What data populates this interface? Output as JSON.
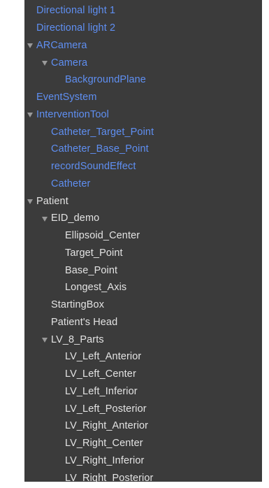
{
  "hierarchy": {
    "items": [
      {
        "label": "Directional light 1",
        "color": "blue",
        "expandable": false
      },
      {
        "label": "Directional light 2",
        "color": "blue",
        "expandable": false
      },
      {
        "label": "ARCamera",
        "color": "blue",
        "expandable": true
      },
      {
        "label": "Camera",
        "color": "blue",
        "expandable": true
      },
      {
        "label": "BackgroundPlane",
        "color": "blue",
        "expandable": false
      },
      {
        "label": "EventSystem",
        "color": "blue",
        "expandable": false
      },
      {
        "label": "InterventionTool",
        "color": "blue",
        "expandable": true
      },
      {
        "label": "Catheter_Target_Point",
        "color": "blue",
        "expandable": false
      },
      {
        "label": "Catheter_Base_Point",
        "color": "blue",
        "expandable": false
      },
      {
        "label": "recordSoundEffect",
        "color": "blue",
        "expandable": false
      },
      {
        "label": "Catheter",
        "color": "blue",
        "expandable": false
      },
      {
        "label": "Patient",
        "color": "white",
        "expandable": true
      },
      {
        "label": "EID_demo",
        "color": "white",
        "expandable": true
      },
      {
        "label": "Ellipsoid_Center",
        "color": "white",
        "expandable": false
      },
      {
        "label": "Target_Point",
        "color": "white",
        "expandable": false
      },
      {
        "label": "Base_Point",
        "color": "white",
        "expandable": false
      },
      {
        "label": "Longest_Axis",
        "color": "white",
        "expandable": false
      },
      {
        "label": "StartingBox",
        "color": "white",
        "expandable": false
      },
      {
        "label": "Patient's Head",
        "color": "white",
        "expandable": false
      },
      {
        "label": "LV_8_Parts",
        "color": "white",
        "expandable": true
      },
      {
        "label": "LV_Left_Anterior",
        "color": "white",
        "expandable": false
      },
      {
        "label": "LV_Left_Center",
        "color": "white",
        "expandable": false
      },
      {
        "label": "LV_Left_Inferior",
        "color": "white",
        "expandable": false
      },
      {
        "label": "LV_Left_Posterior",
        "color": "white",
        "expandable": false
      },
      {
        "label": "LV_Right_Anterior",
        "color": "white",
        "expandable": false
      },
      {
        "label": "LV_Right_Center",
        "color": "white",
        "expandable": false
      },
      {
        "label": "LV_Right_Inferior",
        "color": "white",
        "expandable": false
      },
      {
        "label": "LV_Right_Posterior",
        "color": "white",
        "expandable": false
      }
    ]
  },
  "colors": {
    "background": "#3b3b3b",
    "prefab_text": "#5f8ff2",
    "normal_text": "#e3e3e3",
    "foldout_triangle": "#9a9a9a"
  },
  "icons": {
    "foldout": "triangle-down-icon"
  }
}
